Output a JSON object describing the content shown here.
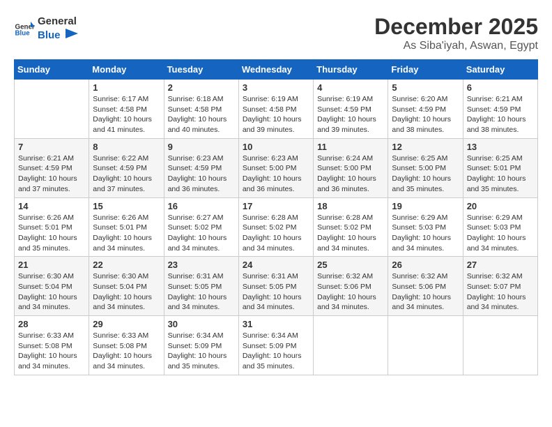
{
  "logo": {
    "general": "General",
    "blue": "Blue"
  },
  "title": "December 2025",
  "location": "As Siba'iyah, Aswan, Egypt",
  "headers": [
    "Sunday",
    "Monday",
    "Tuesday",
    "Wednesday",
    "Thursday",
    "Friday",
    "Saturday"
  ],
  "weeks": [
    [
      {
        "day": "",
        "info": ""
      },
      {
        "day": "1",
        "info": "Sunrise: 6:17 AM\nSunset: 4:58 PM\nDaylight: 10 hours\nand 41 minutes."
      },
      {
        "day": "2",
        "info": "Sunrise: 6:18 AM\nSunset: 4:58 PM\nDaylight: 10 hours\nand 40 minutes."
      },
      {
        "day": "3",
        "info": "Sunrise: 6:19 AM\nSunset: 4:58 PM\nDaylight: 10 hours\nand 39 minutes."
      },
      {
        "day": "4",
        "info": "Sunrise: 6:19 AM\nSunset: 4:59 PM\nDaylight: 10 hours\nand 39 minutes."
      },
      {
        "day": "5",
        "info": "Sunrise: 6:20 AM\nSunset: 4:59 PM\nDaylight: 10 hours\nand 38 minutes."
      },
      {
        "day": "6",
        "info": "Sunrise: 6:21 AM\nSunset: 4:59 PM\nDaylight: 10 hours\nand 38 minutes."
      }
    ],
    [
      {
        "day": "7",
        "info": "Sunrise: 6:21 AM\nSunset: 4:59 PM\nDaylight: 10 hours\nand 37 minutes."
      },
      {
        "day": "8",
        "info": "Sunrise: 6:22 AM\nSunset: 4:59 PM\nDaylight: 10 hours\nand 37 minutes."
      },
      {
        "day": "9",
        "info": "Sunrise: 6:23 AM\nSunset: 4:59 PM\nDaylight: 10 hours\nand 36 minutes."
      },
      {
        "day": "10",
        "info": "Sunrise: 6:23 AM\nSunset: 5:00 PM\nDaylight: 10 hours\nand 36 minutes."
      },
      {
        "day": "11",
        "info": "Sunrise: 6:24 AM\nSunset: 5:00 PM\nDaylight: 10 hours\nand 36 minutes."
      },
      {
        "day": "12",
        "info": "Sunrise: 6:25 AM\nSunset: 5:00 PM\nDaylight: 10 hours\nand 35 minutes."
      },
      {
        "day": "13",
        "info": "Sunrise: 6:25 AM\nSunset: 5:01 PM\nDaylight: 10 hours\nand 35 minutes."
      }
    ],
    [
      {
        "day": "14",
        "info": "Sunrise: 6:26 AM\nSunset: 5:01 PM\nDaylight: 10 hours\nand 35 minutes."
      },
      {
        "day": "15",
        "info": "Sunrise: 6:26 AM\nSunset: 5:01 PM\nDaylight: 10 hours\nand 34 minutes."
      },
      {
        "day": "16",
        "info": "Sunrise: 6:27 AM\nSunset: 5:02 PM\nDaylight: 10 hours\nand 34 minutes."
      },
      {
        "day": "17",
        "info": "Sunrise: 6:28 AM\nSunset: 5:02 PM\nDaylight: 10 hours\nand 34 minutes."
      },
      {
        "day": "18",
        "info": "Sunrise: 6:28 AM\nSunset: 5:02 PM\nDaylight: 10 hours\nand 34 minutes."
      },
      {
        "day": "19",
        "info": "Sunrise: 6:29 AM\nSunset: 5:03 PM\nDaylight: 10 hours\nand 34 minutes."
      },
      {
        "day": "20",
        "info": "Sunrise: 6:29 AM\nSunset: 5:03 PM\nDaylight: 10 hours\nand 34 minutes."
      }
    ],
    [
      {
        "day": "21",
        "info": "Sunrise: 6:30 AM\nSunset: 5:04 PM\nDaylight: 10 hours\nand 34 minutes."
      },
      {
        "day": "22",
        "info": "Sunrise: 6:30 AM\nSunset: 5:04 PM\nDaylight: 10 hours\nand 34 minutes."
      },
      {
        "day": "23",
        "info": "Sunrise: 6:31 AM\nSunset: 5:05 PM\nDaylight: 10 hours\nand 34 minutes."
      },
      {
        "day": "24",
        "info": "Sunrise: 6:31 AM\nSunset: 5:05 PM\nDaylight: 10 hours\nand 34 minutes."
      },
      {
        "day": "25",
        "info": "Sunrise: 6:32 AM\nSunset: 5:06 PM\nDaylight: 10 hours\nand 34 minutes."
      },
      {
        "day": "26",
        "info": "Sunrise: 6:32 AM\nSunset: 5:06 PM\nDaylight: 10 hours\nand 34 minutes."
      },
      {
        "day": "27",
        "info": "Sunrise: 6:32 AM\nSunset: 5:07 PM\nDaylight: 10 hours\nand 34 minutes."
      }
    ],
    [
      {
        "day": "28",
        "info": "Sunrise: 6:33 AM\nSunset: 5:08 PM\nDaylight: 10 hours\nand 34 minutes."
      },
      {
        "day": "29",
        "info": "Sunrise: 6:33 AM\nSunset: 5:08 PM\nDaylight: 10 hours\nand 34 minutes."
      },
      {
        "day": "30",
        "info": "Sunrise: 6:34 AM\nSunset: 5:09 PM\nDaylight: 10 hours\nand 35 minutes."
      },
      {
        "day": "31",
        "info": "Sunrise: 6:34 AM\nSunset: 5:09 PM\nDaylight: 10 hours\nand 35 minutes."
      },
      {
        "day": "",
        "info": ""
      },
      {
        "day": "",
        "info": ""
      },
      {
        "day": "",
        "info": ""
      }
    ]
  ]
}
